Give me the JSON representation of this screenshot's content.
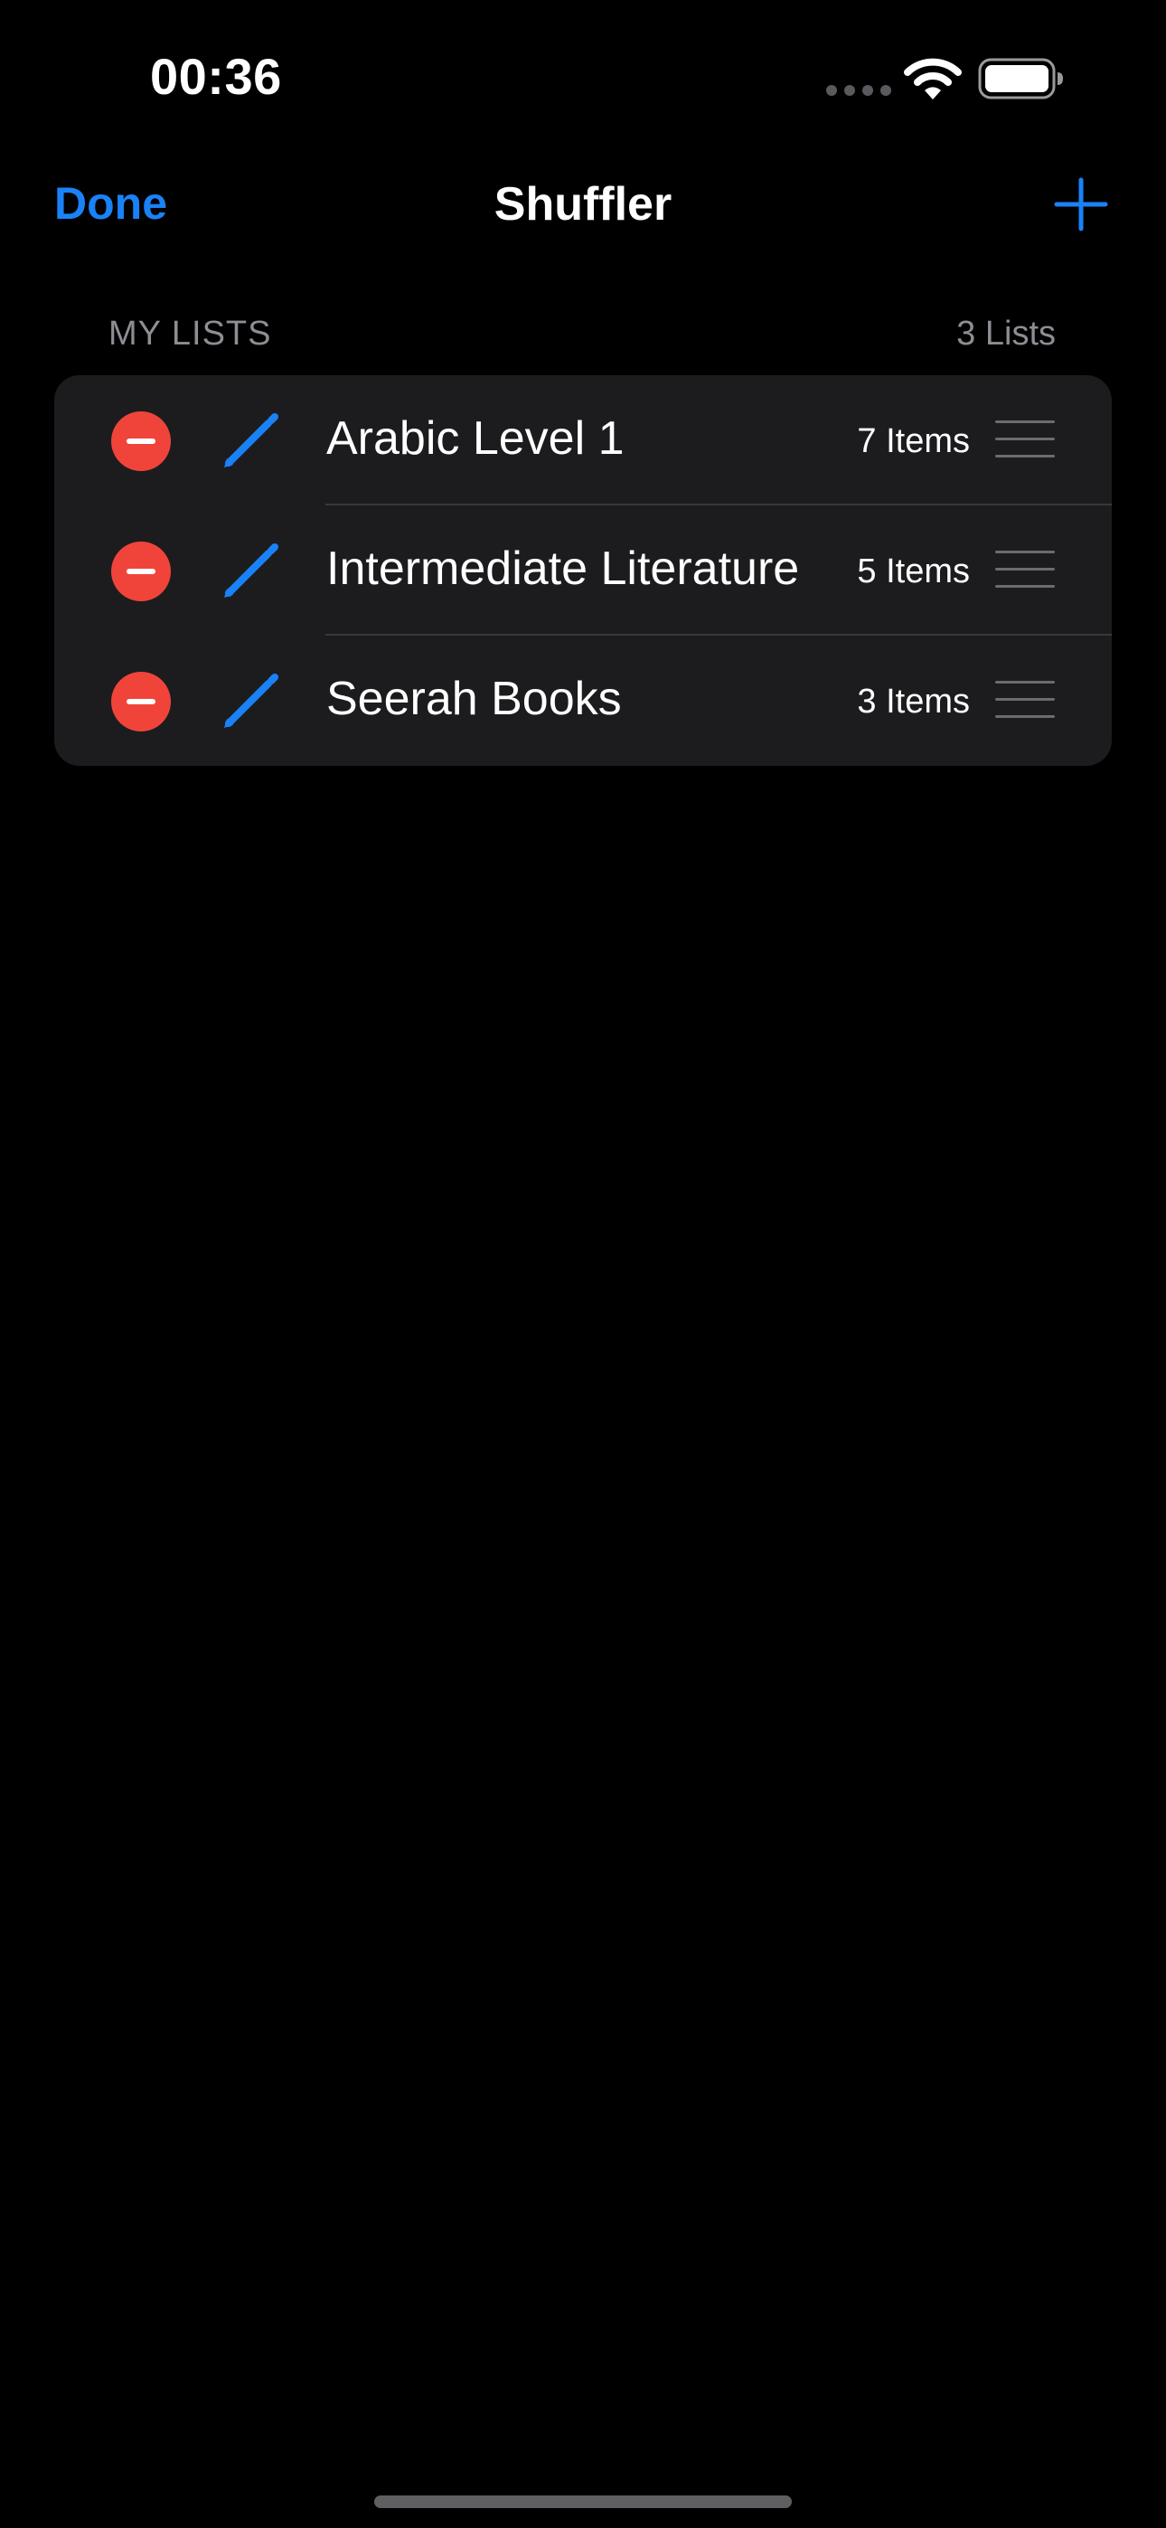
{
  "status_bar": {
    "time": "00:36",
    "icons": [
      "cellular-signal-icon",
      "wifi-icon",
      "battery-icon"
    ]
  },
  "nav": {
    "done_label": "Done",
    "title": "Shuffler",
    "add_icon": "plus-icon"
  },
  "section": {
    "title": "MY LISTS",
    "count": "3 Lists"
  },
  "lists": [
    {
      "title": "Arabic Level 1",
      "count": "7 Items"
    },
    {
      "title": "Intermediate Literature",
      "count": "5 Items"
    },
    {
      "title": "Seerah Books",
      "count": "3 Items"
    }
  ],
  "colors": {
    "accent": "#1a82f7",
    "delete": "#f0443a",
    "background": "#000000",
    "card": "#1c1c1e",
    "secondary_text": "#8d8d93"
  }
}
